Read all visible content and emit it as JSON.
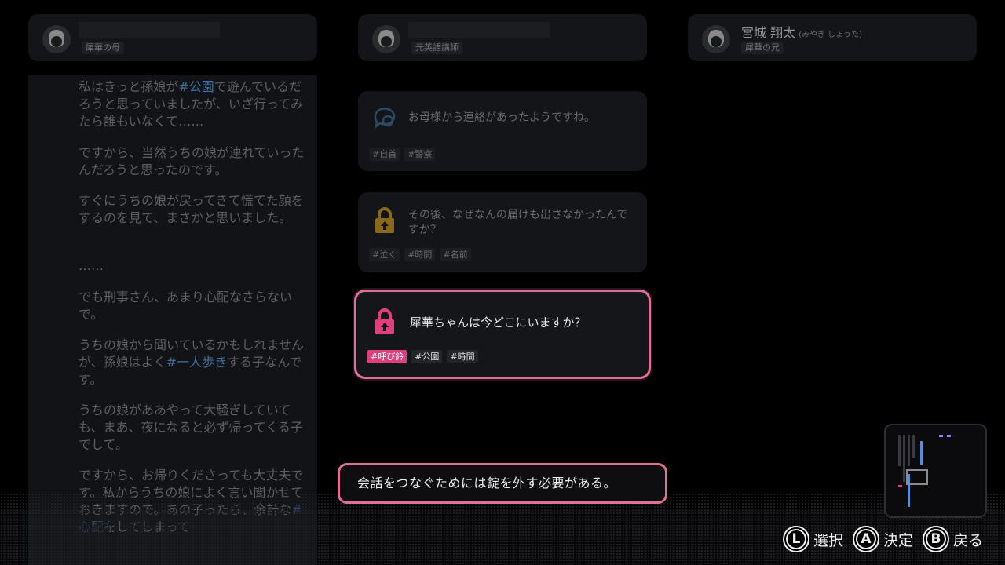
{
  "characters": [
    {
      "role": "犀華の母",
      "name": ""
    },
    {
      "role": "元英語講師",
      "name": ""
    },
    {
      "role": "犀華の兄",
      "name": "宮城 翔太",
      "reading": "(みやぎ しょうた)"
    }
  ],
  "dialogue": {
    "paragraphs": [
      {
        "pre": "私はきっと孫娘が",
        "hl": "#公園",
        "post": "で遊んでいるだろうと思っていましたが、いざ行ってみたら誰もいなくて……"
      },
      {
        "pre": "ですから、当然うちの娘が連れていったんだろうと思ったのです。",
        "hl": "",
        "post": ""
      },
      {
        "pre": "すぐにうちの娘が戻ってきて慌てた顔をするのを見て、まさかと思いました。",
        "hl": "",
        "post": ""
      },
      {
        "pre": "……",
        "hl": "",
        "post": ""
      },
      {
        "pre": "でも刑事さん、あまり心配なさらないで。",
        "hl": "",
        "post": ""
      },
      {
        "pre": "うちの娘から聞いているかもしれませんが、孫娘はよく",
        "hl": "#一人歩き",
        "post": "する子なんです。"
      },
      {
        "pre": "うちの娘がああやって大騒ぎしていても、まあ、夜になると必ず帰ってくる子でして。",
        "hl": "",
        "post": ""
      },
      {
        "pre": "ですから、お帰りくださっても大丈夫です。私からうちの娘によく言い聞かせておきますので。あの子ったら、余計な",
        "hl": "#心配",
        "post": "をしてしまって"
      }
    ]
  },
  "questions": [
    {
      "text": "お母様から連絡があったようですね。",
      "tags": [
        "#自首",
        "#警察"
      ],
      "icon": "speech-bubble-icon",
      "state": "dim"
    },
    {
      "text": "その後、なぜなんの届けも出さなかったんですか？",
      "tags": [
        "#泣く",
        "#時間",
        "#名前"
      ],
      "icon": "padlock-icon",
      "state": "locked"
    },
    {
      "text": "犀華ちゃんは今どこにいますか？",
      "tags": [
        "#呼び鈴",
        "#公園",
        "#時間"
      ],
      "icon": "padlock-icon",
      "state": "selected"
    }
  ],
  "message": "会話をつなぐためには錠を外す必要がある。",
  "controls": [
    {
      "key": "L",
      "label": "選択"
    },
    {
      "key": "A",
      "label": "決定"
    },
    {
      "key": "B",
      "label": "戻る"
    }
  ],
  "colors": {
    "accent": "#e06e98",
    "tag_highlight": "#e03f7e",
    "keyword": "#3f6f9c",
    "lock_gold": "#8a6a18"
  }
}
